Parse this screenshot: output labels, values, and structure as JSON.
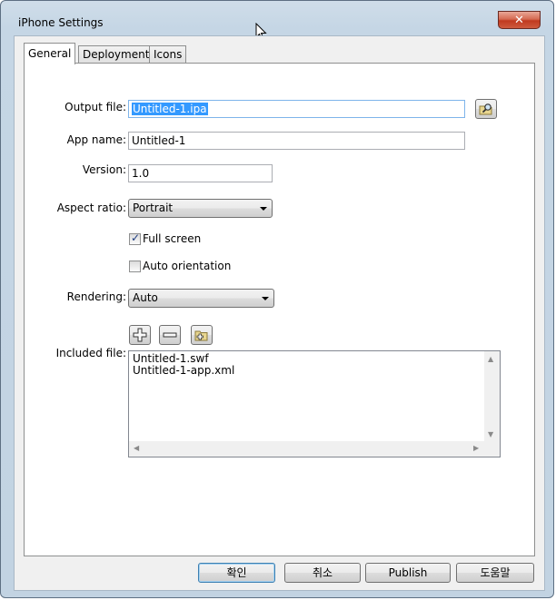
{
  "window": {
    "title": "iPhone Settings",
    "close_label": "✕"
  },
  "tabs": [
    "General",
    "Deployment",
    "Icons"
  ],
  "form": {
    "output_file_label": "Output file:",
    "output_file_value": "Untitled-1.ipa",
    "app_name_label": "App name:",
    "app_name_value": "Untitled-1",
    "version_label": "Version:",
    "version_value": "1.0",
    "aspect_ratio_label": "Aspect ratio:",
    "aspect_ratio_value": "Portrait",
    "full_screen_label": "Full screen",
    "full_screen_checked": true,
    "auto_orientation_label": "Auto orientation",
    "auto_orientation_checked": false,
    "rendering_label": "Rendering:",
    "rendering_value": "Auto",
    "included_files_label": "Included file:",
    "included_files": [
      "Untitled-1.swf",
      "Untitled-1-app.xml"
    ]
  },
  "buttons": {
    "ok": "확인",
    "cancel": "취소",
    "publish": "Publish",
    "help": "도움말"
  },
  "icons": {
    "browse": "folder-search-icon",
    "add": "plus-icon",
    "remove": "minus-icon",
    "add_folder": "folder-add-icon"
  }
}
